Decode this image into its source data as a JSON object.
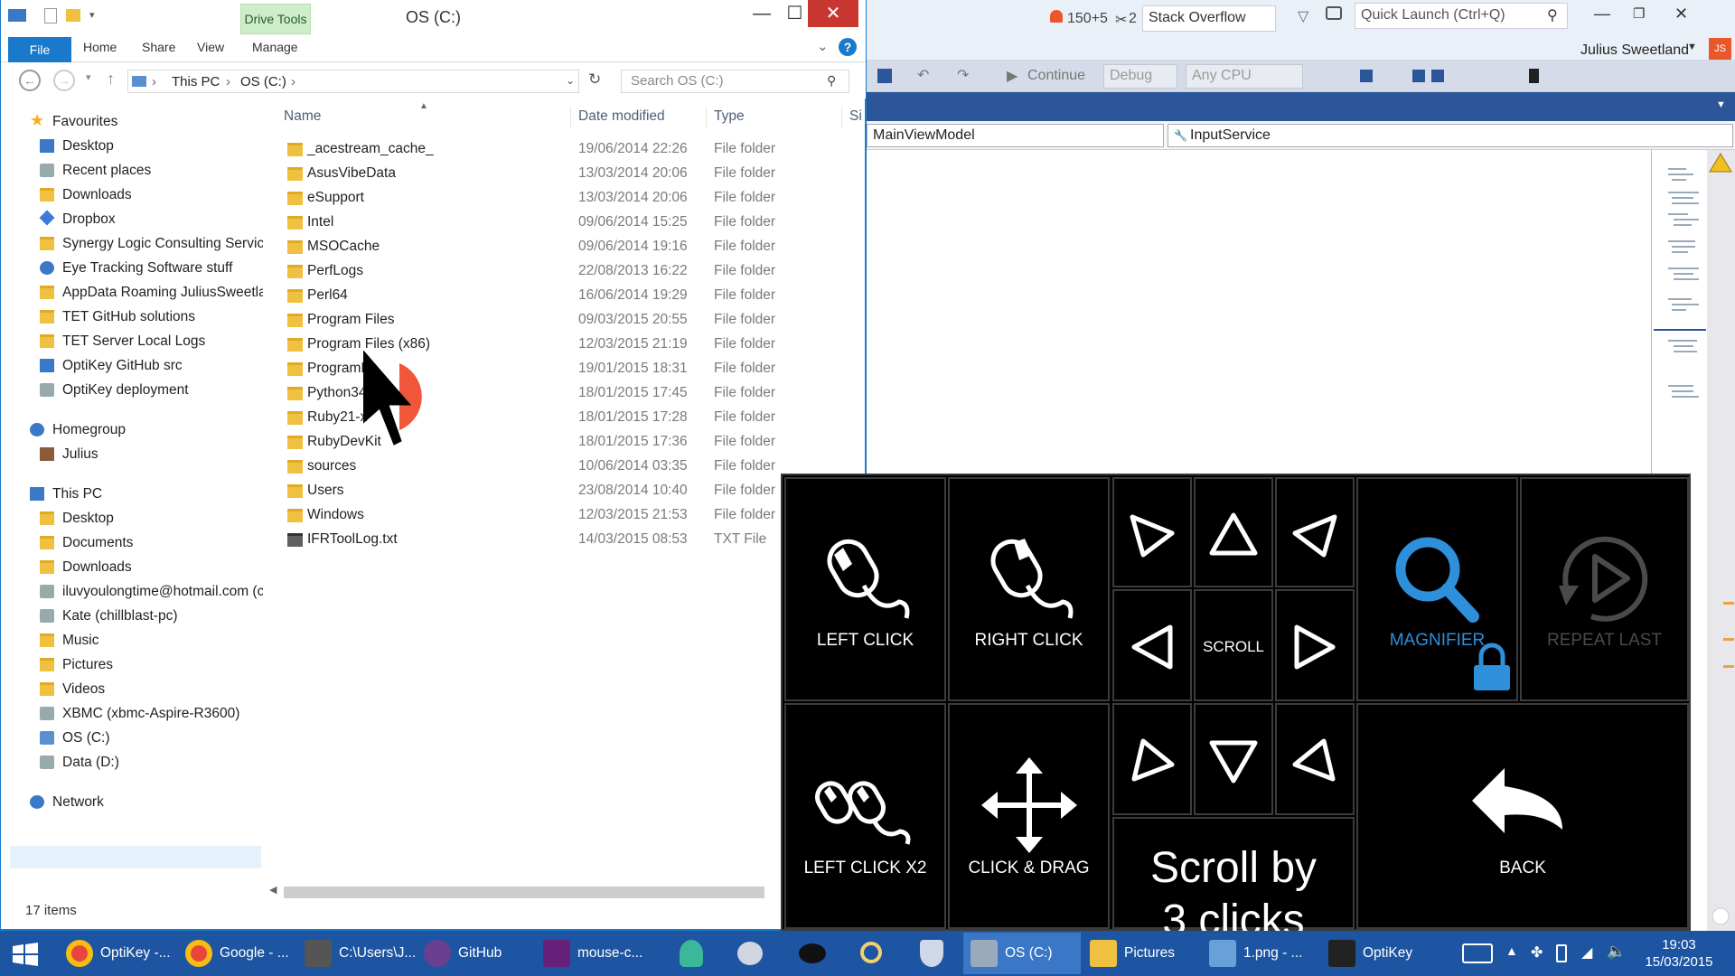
{
  "explorer": {
    "title": "OS (C:)",
    "context_tab": "Drive Tools",
    "window_buttons": {
      "minimize": "—",
      "maximize": "☐",
      "close": "✕"
    },
    "ribbon_tabs": [
      "File",
      "Home",
      "Share",
      "View",
      "Manage"
    ],
    "address": {
      "segments": [
        "This PC",
        "OS (C:)"
      ],
      "sep": "›"
    },
    "search_placeholder": "Search OS (C:)",
    "columns": {
      "name": "Name",
      "date": "Date modified",
      "type": "Type",
      "size": "Si"
    },
    "nav": {
      "favourites_header": "Favourites",
      "favourites": [
        "Desktop",
        "Recent places",
        "Downloads",
        "Dropbox",
        "Synergy Logic Consulting Services",
        "Eye Tracking Software stuff",
        "AppData Roaming JuliusSweetland",
        "TET GitHub solutions",
        "TET Server Local Logs",
        "OptiKey GitHub src",
        "OptiKey deployment"
      ],
      "homegroup_header": "Homegroup",
      "homegroup": [
        "Julius"
      ],
      "thispc_header": "This PC",
      "thispc": [
        "Desktop",
        "Documents",
        "Downloads",
        "iluvyoulongtime@hotmail.com (c",
        "Kate (chillblast-pc)",
        "Music",
        "Pictures",
        "Videos",
        "XBMC (xbmc-Aspire-R3600)",
        "OS (C:)",
        "Data (D:)"
      ],
      "network_header": "Network"
    },
    "files": [
      {
        "name": "_acestream_cache_",
        "date": "19/06/2014 22:26",
        "type": "File folder"
      },
      {
        "name": "AsusVibeData",
        "date": "13/03/2014 20:06",
        "type": "File folder"
      },
      {
        "name": "eSupport",
        "date": "13/03/2014 20:06",
        "type": "File folder"
      },
      {
        "name": "Intel",
        "date": "09/06/2014 15:25",
        "type": "File folder"
      },
      {
        "name": "MSOCache",
        "date": "09/06/2014 19:16",
        "type": "File folder"
      },
      {
        "name": "PerfLogs",
        "date": "22/08/2013 16:22",
        "type": "File folder"
      },
      {
        "name": "Perl64",
        "date": "16/06/2014 19:29",
        "type": "File folder"
      },
      {
        "name": "Program Files",
        "date": "09/03/2015 20:55",
        "type": "File folder"
      },
      {
        "name": "Program Files (x86)",
        "date": "12/03/2015 21:19",
        "type": "File folder"
      },
      {
        "name": "ProgramD",
        "date": "19/01/2015 18:31",
        "type": "File folder"
      },
      {
        "name": "Python34",
        "date": "18/01/2015 17:45",
        "type": "File folder"
      },
      {
        "name": "Ruby21-x",
        "date": "18/01/2015 17:28",
        "type": "File folder"
      },
      {
        "name": "RubyDevKit",
        "date": "18/01/2015 17:36",
        "type": "File folder"
      },
      {
        "name": "sources",
        "date": "10/06/2014 03:35",
        "type": "File folder"
      },
      {
        "name": "Users",
        "date": "23/08/2014 10:40",
        "type": "File folder"
      },
      {
        "name": "Windows",
        "date": "12/03/2015 21:53",
        "type": "File folder"
      },
      {
        "name": "IFRToolLog.txt",
        "date": "14/03/2015 08:53",
        "type": "TXT File"
      }
    ],
    "status": "17 items"
  },
  "vs": {
    "notifications": "150+5",
    "flags": "2",
    "search_so": "Stack Overflow",
    "quick_launch": "Quick Launch (Ctrl+Q)",
    "user": "Julius Sweetland",
    "initials": "JS",
    "continue": "Continue",
    "config": "Debug",
    "platform": "Any CPU",
    "class_dropdown": "MainViewModel",
    "member_dropdown": "InputService"
  },
  "optikey": {
    "left_click": "LEFT CLICK",
    "right_click": "RIGHT CLICK",
    "scroll": "SCROLL",
    "magnifier": "MAGNIFIER",
    "repeat_last": "REPEAT LAST",
    "left_click_x2": "LEFT CLICK X2",
    "click_drag": "CLICK & DRAG",
    "scroll_by": "Scroll by 3 clicks",
    "back": "BACK"
  },
  "taskbar": {
    "items": [
      "OptiKey -...",
      "Google - ...",
      "C:\\Users\\J...",
      "GitHub",
      "mouse-c...",
      "OS (C:)",
      "Pictures",
      "1.png - ...",
      "OptiKey"
    ],
    "time": "19:03",
    "date": "15/03/2015"
  }
}
